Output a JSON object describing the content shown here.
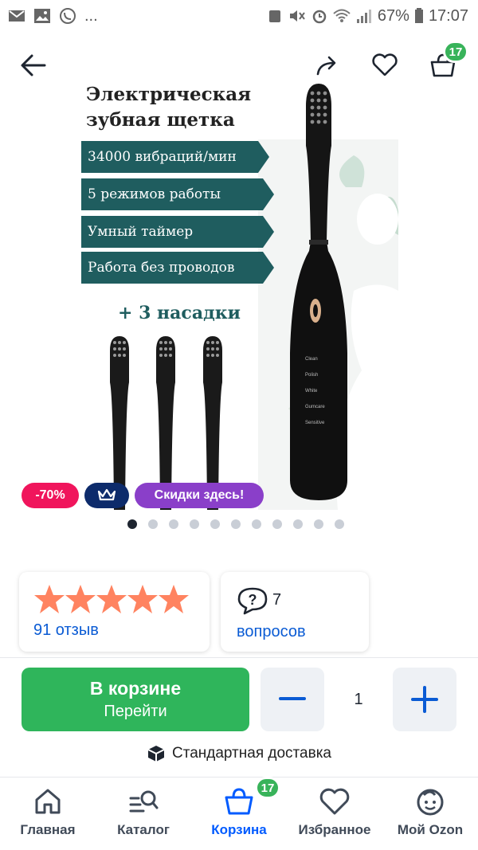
{
  "status_bar": {
    "more": "...",
    "battery": "67%",
    "time": "17:07",
    "icons": [
      "mail-icon",
      "image-icon",
      "viber-icon",
      "android-icon",
      "mute-icon",
      "alarm-icon",
      "wifi-icon",
      "signal-icon",
      "battery-icon"
    ]
  },
  "header": {
    "back_icon": "arrow-left-icon",
    "share_icon": "share-icon",
    "favorite_icon": "heart-icon",
    "cart_icon": "cart-icon",
    "cart_count": "17"
  },
  "product_image": {
    "title": "Электрическая\nзубная щетка",
    "features": [
      "34000 вибраций/мин",
      "5 режимов работы",
      "Умный таймер",
      "Работа без проводов"
    ],
    "nozzles_label": "+ 3 насадки",
    "brush_modes": [
      "Clean",
      "Polish",
      "White",
      "Gumcare",
      "Sensitive"
    ],
    "feature_color": "#1f5d5f"
  },
  "promo": {
    "discount": "-70%",
    "discount_color": "#f0155c",
    "premium_icon": "crown-icon",
    "premium_color": "#0d2b6b",
    "sale_label": "Скидки здесь!",
    "sale_color": "#8a3fc9"
  },
  "gallery": {
    "total": 11,
    "active": 1
  },
  "rating": {
    "stars": 5,
    "reviews_label": "91 отзыв",
    "star_color": "#ff8360"
  },
  "questions": {
    "count": "7",
    "label": "вопросов"
  },
  "purchase": {
    "cart_title": "В корзине",
    "cart_sub": "Перейти",
    "quantity": "1",
    "minus_icon": "minus-icon",
    "plus_icon": "plus-icon",
    "button_color": "#2fb55b",
    "delivery": "Стандартная доставка"
  },
  "tabbar": {
    "items": [
      {
        "label": "Главная",
        "icon": "home-icon"
      },
      {
        "label": "Каталог",
        "icon": "catalog-search-icon"
      },
      {
        "label": "Корзина",
        "icon": "cart-icon",
        "badge": "17",
        "active": true
      },
      {
        "label": "Избранное",
        "icon": "heart-icon"
      },
      {
        "label": "Мой Ozon",
        "icon": "profile-face-icon"
      }
    ],
    "active_color": "#005bff"
  }
}
